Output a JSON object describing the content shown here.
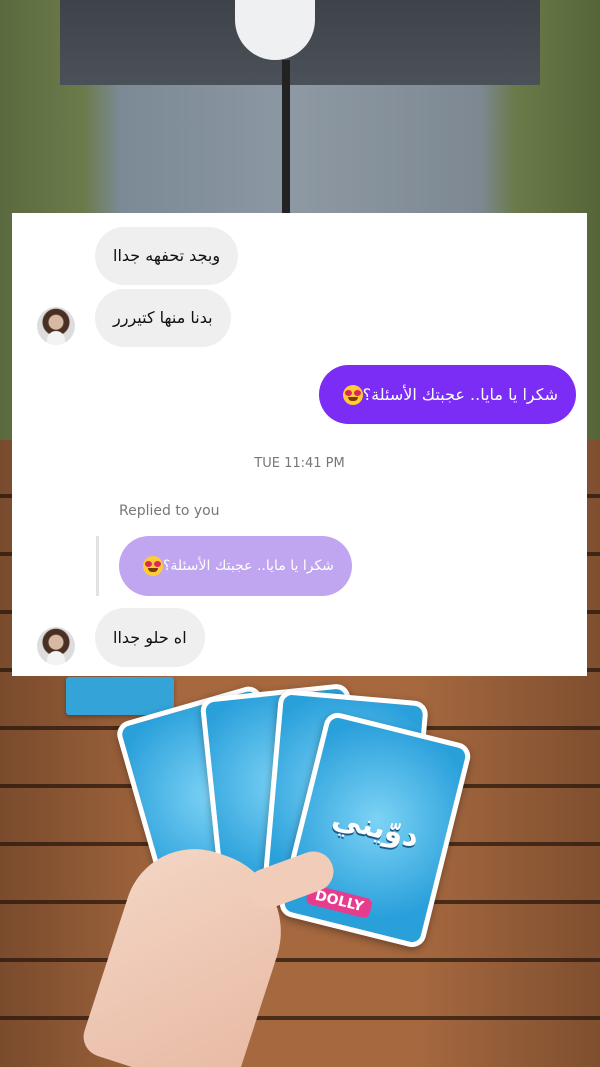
{
  "chat": {
    "messages": [
      {
        "id": "m1",
        "direction": "incoming",
        "text": "وبجد تحفهه جداا"
      },
      {
        "id": "m2",
        "direction": "incoming",
        "text": "بدنا منها كتيررر"
      },
      {
        "id": "m3",
        "direction": "outgoing",
        "text": "شكرا يا مايا.. عجبتك الأسئلة؟",
        "emoji": "heart-eyes-emoji"
      },
      {
        "id": "m4",
        "direction": "incoming",
        "text": "اه حلو جداا"
      }
    ],
    "timestamp": "TUE 11:41 PM",
    "reply": {
      "label": "Replied to you",
      "quoted_text": "شكرا يا مايا.. عجبتك الأسئلة؟",
      "emoji": "heart-eyes-emoji"
    }
  },
  "colors": {
    "outgoing_bubble": "#7b2cf5",
    "incoming_bubble": "#efefef",
    "quoted_bubble": "#c0a6f0"
  },
  "photo": {
    "card_logo": "دوّيني",
    "card_brand": "DOLLY"
  }
}
